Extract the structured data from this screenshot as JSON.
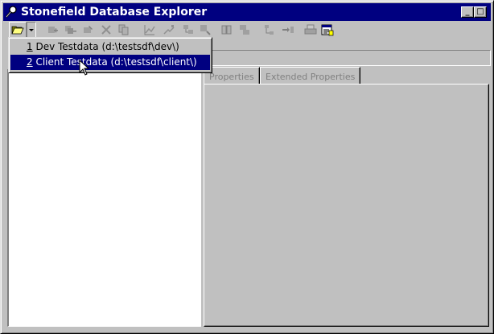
{
  "window": {
    "title": "Stonefield Database Explorer"
  },
  "titlebar_buttons": {
    "minimize": "_",
    "maximize": "□",
    "close": "×"
  },
  "toolbar": {
    "icons": [
      "open-folder",
      "dropdown-arrow",
      "add-item",
      "add-items",
      "edit",
      "delete",
      "copy",
      "chart",
      "find",
      "build",
      "filter",
      "browse",
      "layout",
      "relations",
      "move",
      "export",
      "print",
      "properties"
    ]
  },
  "recent_menu": {
    "items": [
      {
        "number": "1",
        "label": " Dev Testdata (d:\\testsdf\\dev\\)"
      },
      {
        "number": "2",
        "label": " Client Testdata (d:\\testsdf\\client\\)"
      }
    ],
    "selected_index": 1
  },
  "tabs": [
    {
      "label": "Properties"
    },
    {
      "label": "Extended Properties"
    }
  ],
  "colors": {
    "titlebar": "#000080",
    "face": "#c0c0c0",
    "highlight": "#000080"
  }
}
